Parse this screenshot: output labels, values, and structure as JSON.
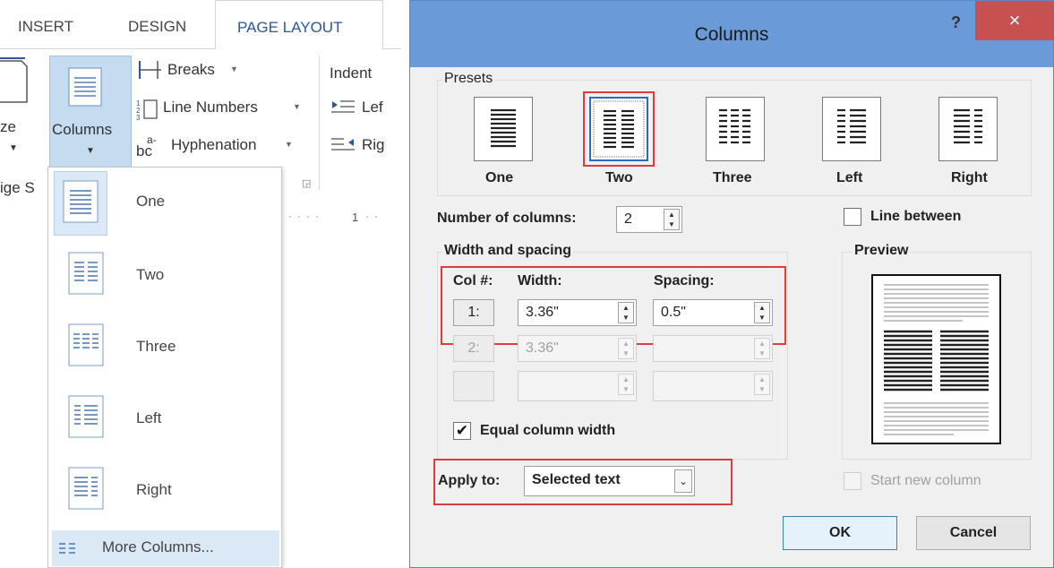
{
  "ribbon": {
    "tabs": [
      "INSERT",
      "DESIGN",
      "PAGE LAYOUT"
    ],
    "active_tab": "PAGE LAYOUT",
    "size_partial": "ze",
    "page_setup_partial": "ige S",
    "columns_label": "Columns",
    "breaks": "Breaks",
    "line_numbers": "Line Numbers",
    "hyphenation": "Hyphenation",
    "indent": "Indent",
    "left_partial": "Lef",
    "right_partial": "Rig",
    "ruler_mark": "1"
  },
  "columns_menu": {
    "items": [
      "One",
      "Two",
      "Three",
      "Left",
      "Right"
    ],
    "selected": "One",
    "more": "More Columns..."
  },
  "dialog": {
    "title": "Columns",
    "help": "?",
    "close": "×",
    "presets_label": "Presets",
    "presets": [
      "One",
      "Two",
      "Three",
      "Left",
      "Right"
    ],
    "selected_preset": "Two",
    "num_columns_label": "Number of columns:",
    "num_columns_value": "2",
    "line_between_label": "Line between",
    "line_between_checked": false,
    "width_spacing_label": "Width and spacing",
    "col_header": "Col #:",
    "width_header": "Width:",
    "spacing_header": "Spacing:",
    "rows": [
      {
        "col": "1:",
        "width": "3.36\"",
        "spacing": "0.5\"",
        "enabled": true
      },
      {
        "col": "2:",
        "width": "3.36\"",
        "spacing": "",
        "enabled": false
      },
      {
        "col": "",
        "width": "",
        "spacing": "",
        "enabled": false
      }
    ],
    "equal_width_label": "Equal column width",
    "equal_width_checked": true,
    "preview_label": "Preview",
    "apply_to_label": "Apply to:",
    "apply_to_value": "Selected text",
    "start_new_column_label": "Start new column",
    "ok": "OK",
    "cancel": "Cancel",
    "highlight_color": "#e23b3b"
  }
}
